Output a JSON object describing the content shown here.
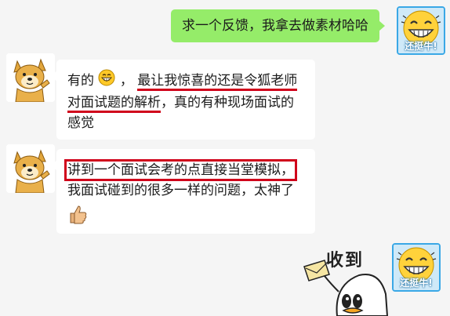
{
  "messages": [
    {
      "side": "right",
      "text": "求一个反馈，我拿去做素材哈哈"
    },
    {
      "side": "left",
      "line1_a": "有的",
      "line1_emoji": "grin-emoji",
      "line1_b": "，",
      "line1_c": "最让我惊喜的还是令狐老师",
      "line2_a": "对面试题的解析",
      "line2_b": "，真的有种现场面试的",
      "line3": "感觉"
    },
    {
      "side": "left",
      "line1": "讲到一个面试会考的点直接当堂模拟，",
      "line2": "我面试碰到的很多一样的问题，太神了",
      "line3_emoji": "thumbs-up-emoji"
    }
  ],
  "sticker": {
    "text": "收到"
  },
  "avatars": {
    "right_caption": "还挺牛!"
  },
  "colors": {
    "green_bubble": "#95ec69",
    "highlight": "#d0021b",
    "background": "#f5f5f5"
  }
}
